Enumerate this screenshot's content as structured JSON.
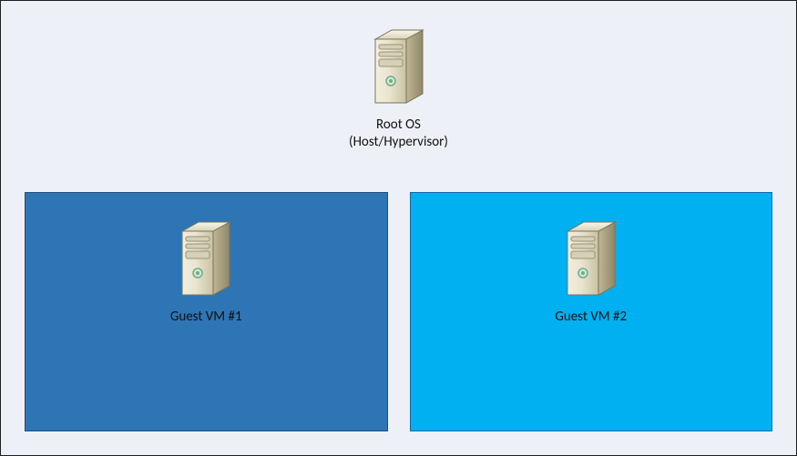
{
  "root": {
    "label_line1": "Root OS",
    "label_line2": "(Host/Hypervisor)",
    "icon": "server-tower-icon"
  },
  "guests": [
    {
      "label": "Guest VM #1",
      "icon": "server-tower-icon",
      "color": "#2E75B6"
    },
    {
      "label": "Guest VM #2",
      "icon": "server-tower-icon",
      "color": "#00B0F0"
    }
  ]
}
